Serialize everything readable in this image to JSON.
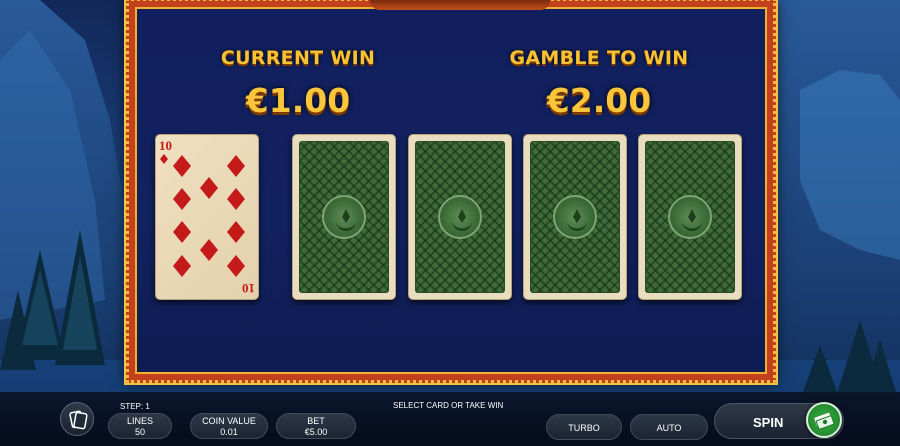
{
  "game": {
    "current_win_label": "CURRENT WIN",
    "current_win_value": "€1.00",
    "gamble_to_win_label": "GAMBLE TO WIN",
    "gamble_to_win_value": "€2.00",
    "revealed_card": {
      "rank": "10",
      "suit": "diamonds",
      "color": "#c41a1a"
    },
    "face_down_cards": 4
  },
  "bottom_bar": {
    "step": "STEP: 1",
    "instruction": "SELECT CARD OR TAKE WIN",
    "lines_label": "LINES",
    "lines_value": "50",
    "coin_value_label": "COIN VALUE",
    "coin_value": "0.01",
    "bet_label": "BET",
    "bet_value": "€5.00",
    "turbo_label": "TURBO",
    "auto_label": "AUTO",
    "spin_label": "SPIN"
  },
  "colors": {
    "accent_gold": "#f7c234",
    "frame_red": "#c2401c",
    "panel_navy": "#12215f",
    "spin_green": "#2c9a38"
  },
  "icons": {
    "menu": "cards-menu-icon",
    "spin": "money-stack-icon",
    "card_back": "crescent-emblem-icon"
  }
}
